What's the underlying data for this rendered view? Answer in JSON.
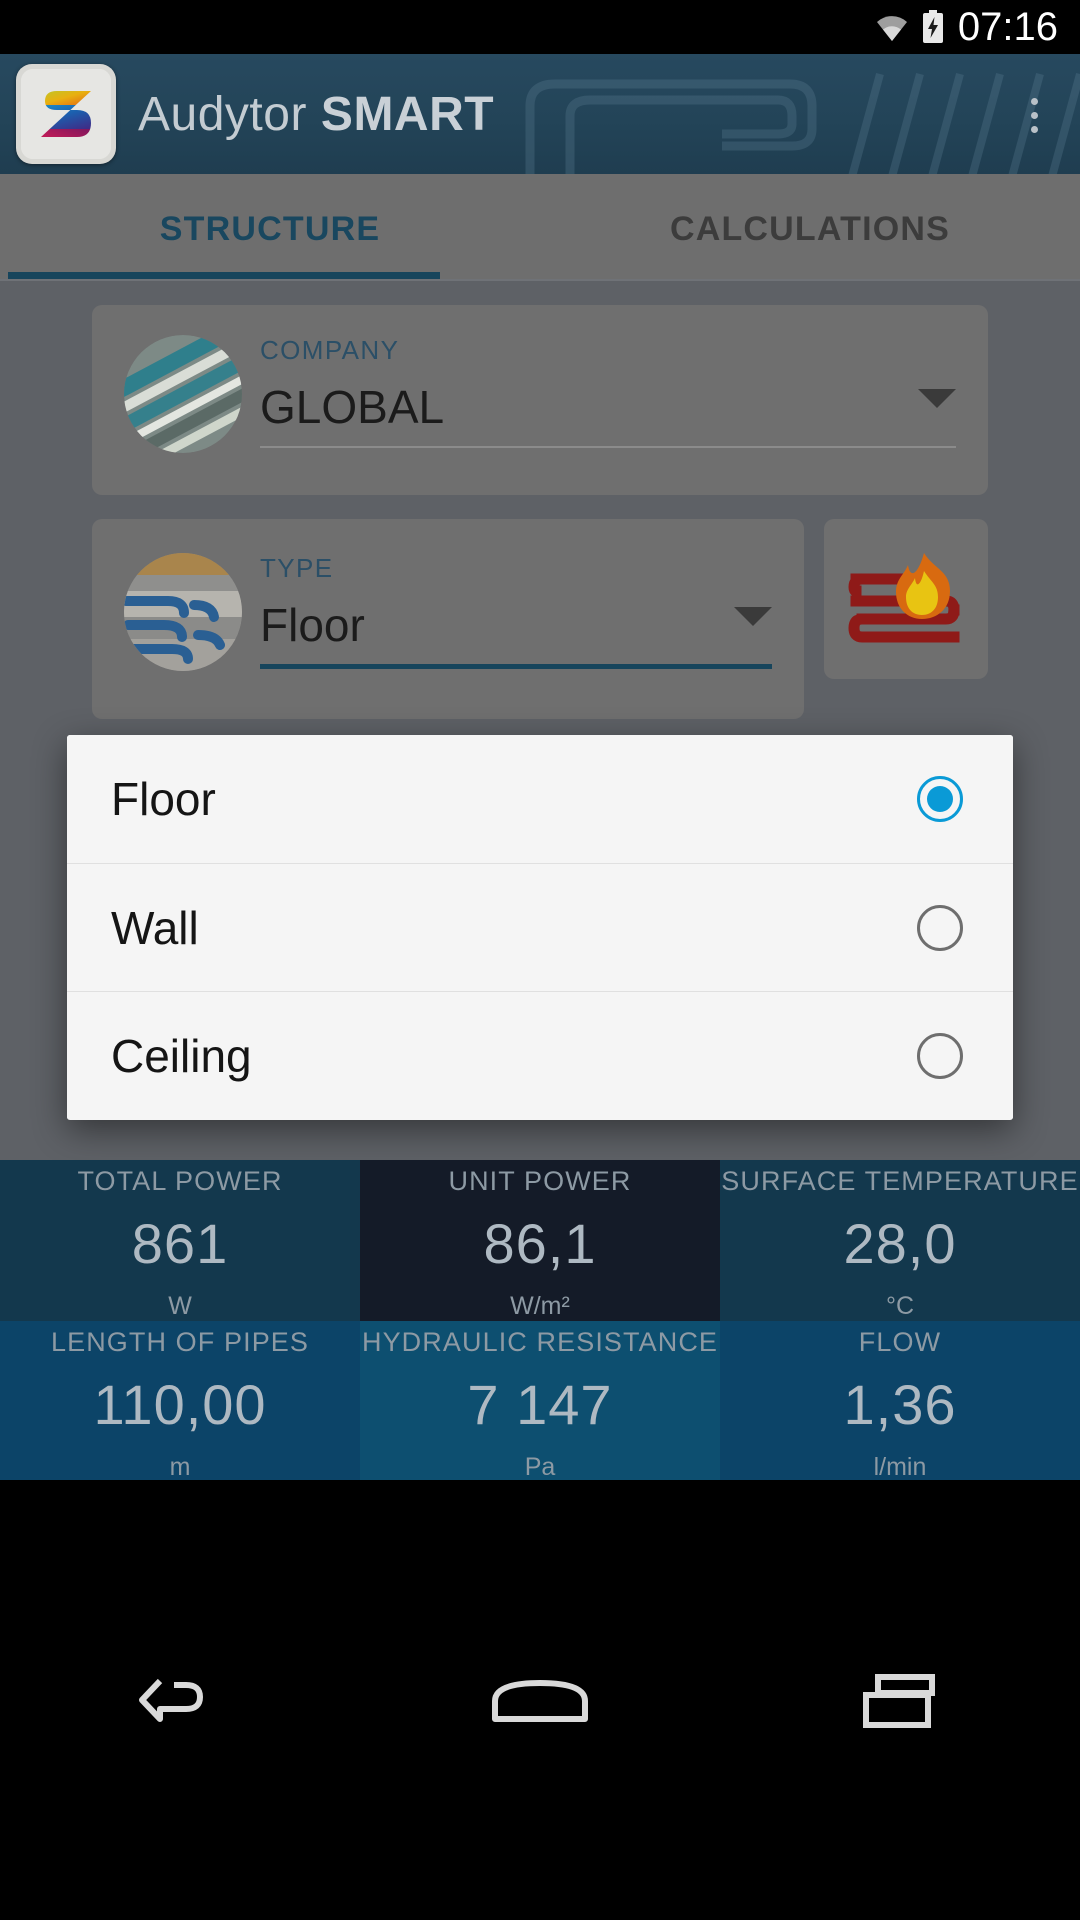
{
  "statusbar": {
    "time": "07:16",
    "wifi_icon": "wifi-icon",
    "battery_icon": "battery-charging-icon"
  },
  "appbar": {
    "title_light": "Audytor",
    "title_bold": "SMART",
    "logo_icon": "audytor-s-logo",
    "overflow_icon": "overflow-menu-icon"
  },
  "tabs": {
    "items": [
      {
        "label": "STRUCTURE",
        "active": true
      },
      {
        "label": "CALCULATIONS",
        "active": false
      }
    ],
    "indicator_color": "#17455c"
  },
  "form": {
    "company": {
      "label": "COMPANY",
      "value": "GLOBAL",
      "thumb_icon": "company-building-thumb",
      "caret_icon": "chevron-down-icon"
    },
    "type": {
      "label": "TYPE",
      "value": "Floor",
      "thumb_icon": "floor-pipes-thumb",
      "caret_icon": "chevron-down-icon",
      "underline_color": "#17455c"
    },
    "heating_tile": {
      "icon": "floor-heating-flame-icon"
    },
    "third_card": {
      "thumb_icon": "dark-circle-thumb"
    }
  },
  "dialog": {
    "options": [
      {
        "label": "Floor",
        "selected": true
      },
      {
        "label": "Wall",
        "selected": false
      },
      {
        "label": "Ceiling",
        "selected": false
      }
    ],
    "accent_color": "#0a9ad6"
  },
  "stats": [
    {
      "label": "TOTAL POWER",
      "value": "861",
      "unit": "W",
      "bg": "#13384d"
    },
    {
      "label": "UNIT POWER",
      "value": "86,1",
      "unit": "W/m²",
      "bg": "#141b28"
    },
    {
      "label": "SURFACE TEMPERATURE",
      "value": "28,0",
      "unit": "°C",
      "bg": "#13384d"
    },
    {
      "label": "LENGTH OF PIPES",
      "value": "110,00",
      "unit": "m",
      "bg": "#0c4468"
    },
    {
      "label": "HYDRAULIC RESISTANCE",
      "value": "7 147",
      "unit": "Pa",
      "bg": "#0d4f70"
    },
    {
      "label": "FLOW",
      "value": "1,36",
      "unit": "l/min",
      "bg": "#0c4468"
    }
  ],
  "navbar": {
    "back_icon": "back-arrow-icon",
    "home_icon": "home-icon",
    "recents_icon": "recent-apps-icon"
  }
}
